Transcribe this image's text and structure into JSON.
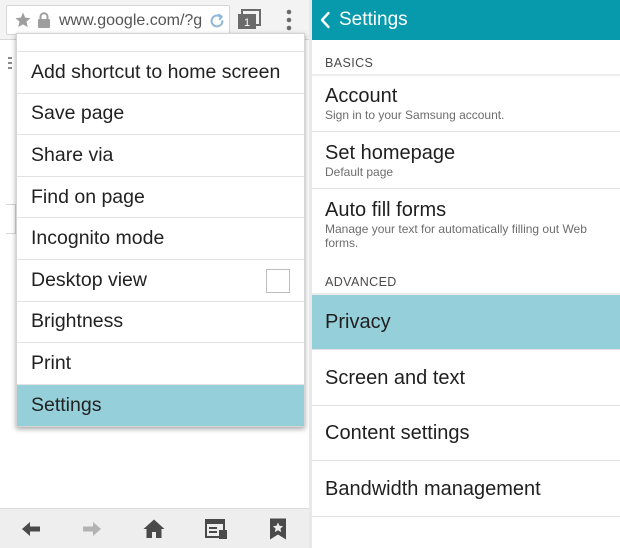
{
  "browser": {
    "url": "www.google.com/?g",
    "tab_count": "1",
    "menu_items": [
      {
        "label": "Add shortcut to home screen"
      },
      {
        "label": "Save page"
      },
      {
        "label": "Share via"
      },
      {
        "label": "Find on page"
      },
      {
        "label": "Incognito mode"
      },
      {
        "label": "Desktop view",
        "checkbox": true,
        "checked": false
      },
      {
        "label": "Brightness"
      },
      {
        "label": "Print"
      },
      {
        "label": "Settings",
        "selected": true
      }
    ],
    "bottom_nav_icons": [
      "back-arrow-icon",
      "forward-arrow-icon",
      "home-icon",
      "reader-icon",
      "bookmark-star-icon"
    ]
  },
  "settings": {
    "title": "Settings",
    "sections": [
      {
        "header": "BASICS",
        "items": [
          {
            "title": "Account",
            "subtitle": "Sign in to your Samsung account."
          },
          {
            "title": "Set homepage",
            "subtitle": "Default page"
          },
          {
            "title": "Auto fill forms",
            "subtitle": "Manage your text for automatically filling out Web forms."
          }
        ]
      },
      {
        "header": "ADVANCED",
        "items": [
          {
            "title": "Privacy",
            "selected": true
          },
          {
            "title": "Screen and text"
          },
          {
            "title": "Content settings"
          },
          {
            "title": "Bandwidth management"
          }
        ]
      }
    ]
  },
  "colors": {
    "header_teal": "#079aad",
    "selected_highlight": "#95d0da",
    "toolbar_gray": "#f3f3f3",
    "bottom_bar_gray": "#eeeeee"
  }
}
